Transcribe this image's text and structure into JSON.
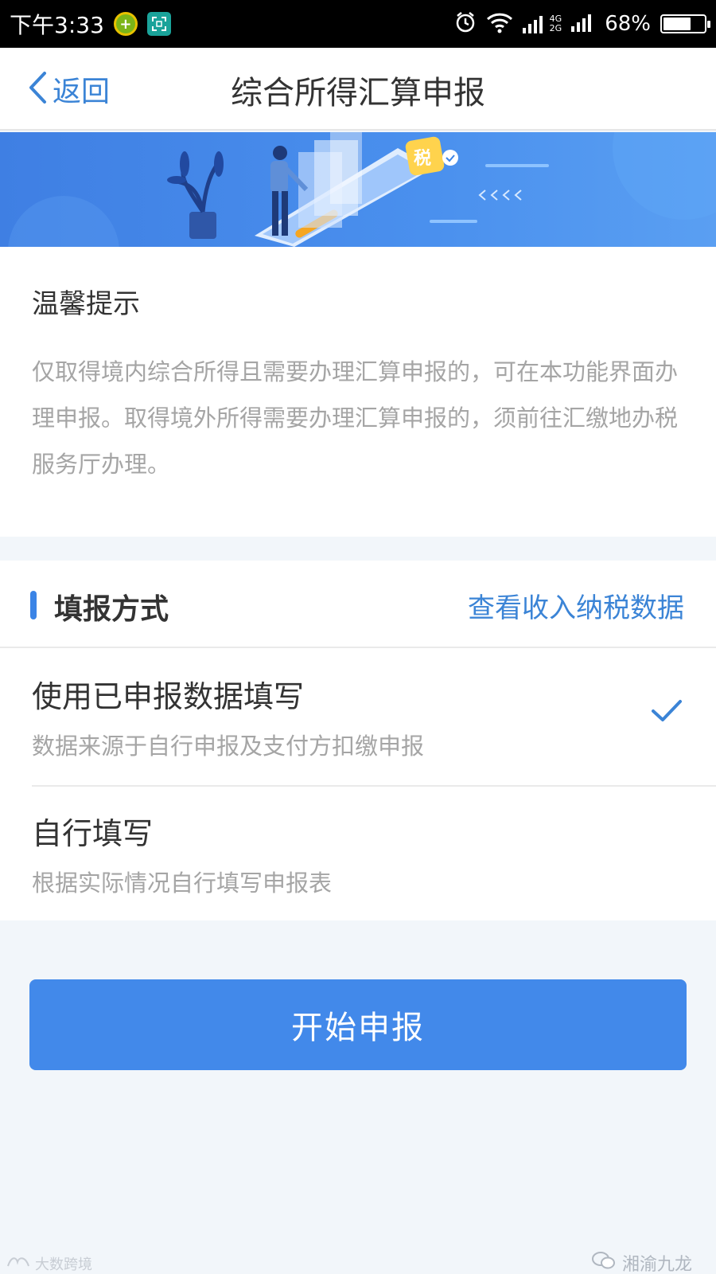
{
  "status_bar": {
    "time": "下午3:33",
    "battery_text": "68%",
    "battery_level": 0.68,
    "network_labels": [
      "4G",
      "2G"
    ]
  },
  "nav": {
    "back_label": "返回",
    "title": "综合所得汇算申报"
  },
  "banner": {
    "tax_badge": "税"
  },
  "tip": {
    "title": "温馨提示",
    "text": "仅取得境内综合所得且需要办理汇算申报的，可在本功能界面办理申报。取得境外所得需要办理汇算申报的，须前往汇缴地办税服务厅办理。"
  },
  "method": {
    "section_title": "填报方式",
    "view_data_link": "查看收入纳税数据",
    "options": [
      {
        "title": "使用已申报数据填写",
        "desc": "数据来源于自行申报及支付方扣缴申报",
        "selected": true
      },
      {
        "title": "自行填写",
        "desc": "根据实际情况自行填写申报表",
        "selected": false
      }
    ]
  },
  "submit": {
    "label": "开始申报"
  },
  "watermarks": {
    "right": "湘渝九龙",
    "left": "大数跨境"
  },
  "colors": {
    "accent": "#4289ea",
    "link": "#3b84d6",
    "banner": "#4a90ee",
    "page_bg": "#f2f6fa"
  }
}
